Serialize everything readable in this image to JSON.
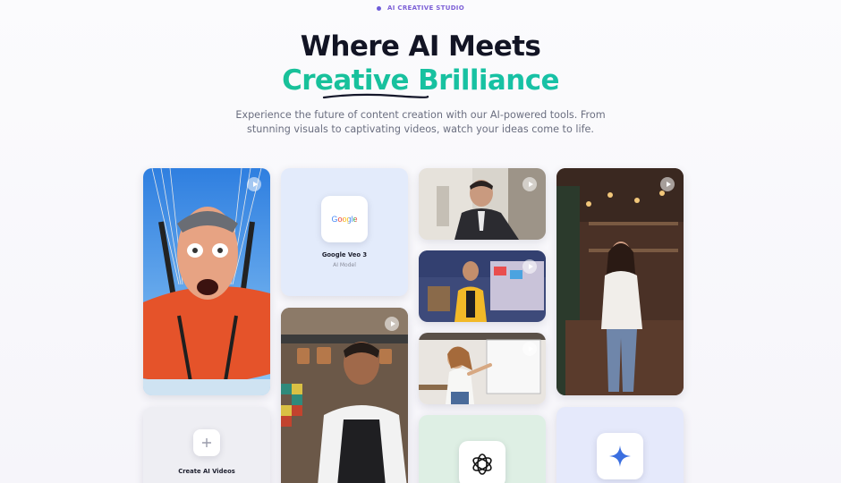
{
  "badge": {
    "label": "AI CREATIVE STUDIO"
  },
  "hero": {
    "title_line1": "Where AI Meets",
    "title_line2": "Creative Brilliance",
    "subtitle": "Experience the future of content creation with our AI-powered tools. From stunning visuals to captivating videos, watch your ideas come to life."
  },
  "gallery": {
    "google_tile": {
      "logo_text": "Google",
      "title": "Google Veo 3",
      "subtitle": "AI Model"
    },
    "create_tile": {
      "title": "Create AI Videos"
    },
    "colors": {
      "accent_green": "#16c79a",
      "accent_purple": "#6d5bd9",
      "gemini_blue": "#3b6fe0"
    },
    "icons": [
      "play-icon",
      "plus-icon",
      "openai-icon",
      "sparkle-icon",
      "google-logo"
    ]
  }
}
